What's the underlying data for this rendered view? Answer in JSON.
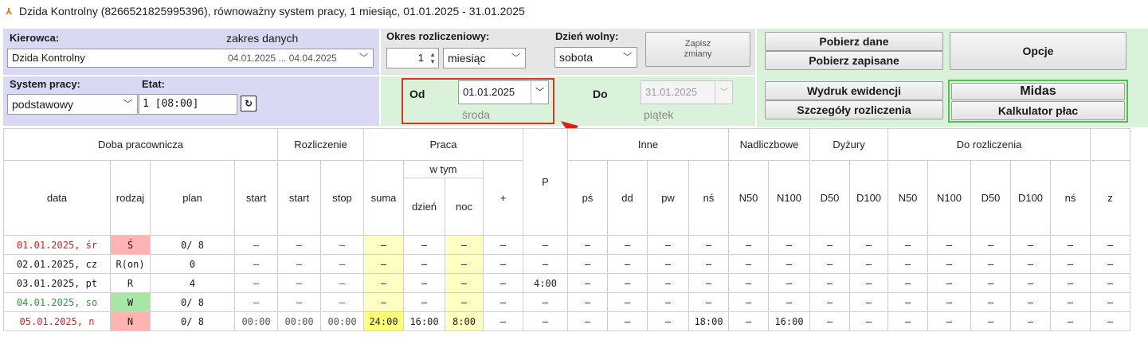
{
  "window": {
    "title": "Dzida Kontrolny (8266521825995396), równoważny system pracy, 1 miesiąc, 01.01.2025 - 31.01.2025"
  },
  "driver": {
    "label": "Kierowca:",
    "range_label": "zakres danych",
    "name": "Dzida Kontrolny",
    "range": "04.01.2025 ... 04.04.2025"
  },
  "period": {
    "label": "Okres rozliczeniowy:",
    "count": "1",
    "unit": "miesiąc"
  },
  "dayoff": {
    "label": "Dzień wolny:",
    "value": "sobota"
  },
  "save": {
    "line1": "Zapisz",
    "line2": "zmiany"
  },
  "buttons": {
    "fetch": "Pobierz dane",
    "fetch_saved": "Pobierz zapisane",
    "options": "Opcje",
    "print": "Wydruk ewidencji",
    "details": "Szczegóły rozliczenia",
    "midas": "Midas",
    "calc": "Kalkulator płac"
  },
  "system": {
    "label": "System pracy:",
    "etat_label": "Etat:",
    "value": "podstawowy",
    "etat": "1  [08:00]"
  },
  "from": {
    "label": "Od",
    "date": "01.01.2025",
    "weekday": "środa"
  },
  "to": {
    "label": "Do",
    "date": "31.01.2025",
    "weekday": "piątek"
  },
  "colors": {
    "annotation": "#e01e1e",
    "holiday_bg": "#ffb3b3",
    "weekend_bg": "#a8e6a8",
    "highlight": "#ffffc4"
  },
  "table": {
    "groups": {
      "doba": "Doba pracownicza",
      "rozliczenie": "Rozliczenie",
      "praca": "Praca",
      "wtym": "w tym",
      "p": "P",
      "inne": "Inne",
      "nadliczbowe": "Nadliczbowe",
      "dyzury": "Dyżury",
      "do_rozliczenia": "Do rozliczenia"
    },
    "cols": {
      "data": "data",
      "rodzaj": "rodzaj",
      "plan": "plan",
      "start": "start",
      "r_start": "start",
      "r_stop": "stop",
      "suma": "suma",
      "dzien": "dzień",
      "noc": "noc",
      "plus": "+",
      "ps": "pś",
      "dd": "dd",
      "pw": "pw",
      "ns": "nś",
      "n50": "N50",
      "n100": "N100",
      "d50": "D50",
      "d100": "D100",
      "r_n50": "N50",
      "r_n100": "N100",
      "r_d50": "D50",
      "r_d100": "D100",
      "r_ns": "nś",
      "z": "z"
    },
    "rows": [
      {
        "date": "01.01.2025, śr",
        "kind": "Ś",
        "plan": "0/ 8",
        "start": "–",
        "r_start": "–",
        "r_stop": "–",
        "suma": "–",
        "dzien": "–",
        "noc": "–",
        "plus": "–",
        "p": "–",
        "ps": "–",
        "dd": "–",
        "pw": "–",
        "ns": "–",
        "n50": "–",
        "n100": "–",
        "d50": "–",
        "d100": "–",
        "r_n50": "–",
        "r_n100": "–",
        "r_d50": "–",
        "r_d100": "–",
        "r_ns": "–",
        "z": "–"
      },
      {
        "date": "02.01.2025, cz",
        "kind": "R(on)",
        "plan": "0",
        "start": "–",
        "r_start": "–",
        "r_stop": "–",
        "suma": "–",
        "dzien": "–",
        "noc": "–",
        "plus": "–",
        "p": "–",
        "ps": "–",
        "dd": "–",
        "pw": "–",
        "ns": "–",
        "n50": "–",
        "n100": "–",
        "d50": "–",
        "d100": "–",
        "r_n50": "–",
        "r_n100": "–",
        "r_d50": "–",
        "r_d100": "–",
        "r_ns": "–",
        "z": "–"
      },
      {
        "date": "03.01.2025, pt",
        "kind": "R",
        "plan": "4",
        "start": "–",
        "r_start": "–",
        "r_stop": "–",
        "suma": "–",
        "dzien": "–",
        "noc": "–",
        "plus": "–",
        "p": "4:00",
        "ps": "–",
        "dd": "–",
        "pw": "–",
        "ns": "–",
        "n50": "–",
        "n100": "–",
        "d50": "–",
        "d100": "–",
        "r_n50": "–",
        "r_n100": "–",
        "r_d50": "–",
        "r_d100": "–",
        "r_ns": "–",
        "z": "–"
      },
      {
        "date": "04.01.2025, so",
        "kind": "W",
        "plan": "0/ 8",
        "start": "–",
        "r_start": "–",
        "r_stop": "–",
        "suma": "–",
        "dzien": "–",
        "noc": "–",
        "plus": "–",
        "p": "–",
        "ps": "–",
        "dd": "–",
        "pw": "–",
        "ns": "–",
        "n50": "–",
        "n100": "–",
        "d50": "–",
        "d100": "–",
        "r_n50": "–",
        "r_n100": "–",
        "r_d50": "–",
        "r_d100": "–",
        "r_ns": "–",
        "z": "–"
      },
      {
        "date": "05.01.2025, n",
        "kind": "N",
        "plan": "0/ 8",
        "start": "00:00",
        "r_start": "00:00",
        "r_stop": "00:00",
        "suma": "24:00",
        "dzien": "16:00",
        "noc": "8:00",
        "plus": "–",
        "p": "–",
        "ps": "–",
        "dd": "–",
        "pw": "–",
        "ns": "18:00",
        "n50": "–",
        "n100": "16:00",
        "d50": "–",
        "d100": "–",
        "r_n50": "–",
        "r_n100": "–",
        "r_d50": "–",
        "r_d100": "–",
        "r_ns": "–",
        "z": "–"
      }
    ]
  }
}
